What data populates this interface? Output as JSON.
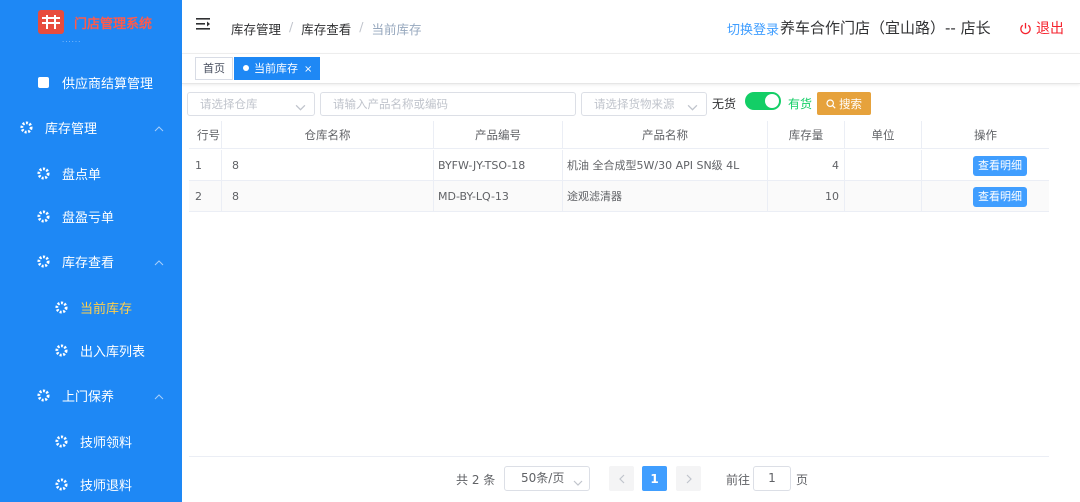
{
  "app": {
    "title": "门店管理系统",
    "subtitle": "......",
    "brand_color": "#1e88f5"
  },
  "sidebar": {
    "items": [
      {
        "label": "供应商结算管理",
        "icon": "square-icon"
      },
      {
        "label": "库存管理",
        "icon": "gear-icon",
        "expanded": true
      },
      {
        "label": "盘点单",
        "icon": "gear-icon"
      },
      {
        "label": "盘盈亏单",
        "icon": "gear-icon"
      },
      {
        "label": "库存查看",
        "icon": "gear-icon",
        "expanded": true
      },
      {
        "label": "当前库存",
        "icon": "gear-icon",
        "active": true
      },
      {
        "label": "出入库列表",
        "icon": "gear-icon"
      },
      {
        "label": "上门保养",
        "icon": "gear-icon",
        "expanded": true
      },
      {
        "label": "技师领料",
        "icon": "gear-icon"
      },
      {
        "label": "技师退料",
        "icon": "gear-icon"
      }
    ]
  },
  "header": {
    "breadcrumb": [
      "库存管理",
      "库存查看",
      "当前库存"
    ],
    "switch_login": "切换登录",
    "store": "养车合作门店（宜山路）-- 店长",
    "logout": "退出"
  },
  "tags": {
    "home": "首页",
    "current": "当前库存",
    "close": "×"
  },
  "filters": {
    "warehouse_placeholder": "请选择仓库",
    "product_placeholder": "请输入产品名称或编码",
    "source_placeholder": "请选择货物来源",
    "no_stock_label": "无货",
    "in_stock_label": "有货",
    "in_stock_on": true,
    "search_label": "搜索"
  },
  "table": {
    "columns": [
      "行号",
      "仓库名称",
      "产品编号",
      "产品名称",
      "库存量",
      "单位",
      "操作"
    ],
    "rows": [
      {
        "no": "1",
        "warehouse": "8",
        "code": "BYFW-JY-TSO-18",
        "name": "机油 全合成型5W/30 API SN级 4L",
        "qty": "4",
        "unit": "",
        "action": "查看明细"
      },
      {
        "no": "2",
        "warehouse": "8",
        "code": "MD-BY-LQ-13",
        "name": "途观滤清器",
        "qty": "10",
        "unit": "",
        "action": "查看明细"
      }
    ]
  },
  "pagination": {
    "total": "共 2 条",
    "page_size": "50条/页",
    "current_page": "1",
    "goto_prefix": "前往",
    "goto_value": "1",
    "goto_suffix": "页"
  }
}
